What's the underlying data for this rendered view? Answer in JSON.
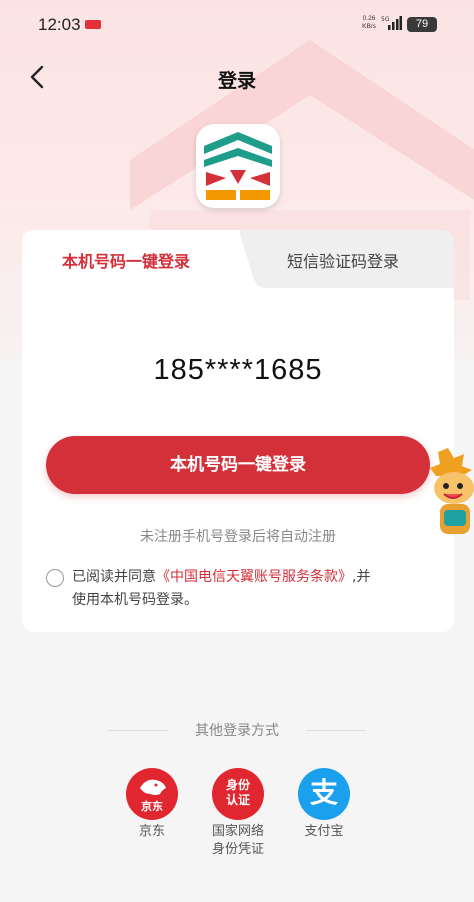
{
  "status_bar": {
    "time": "12:03",
    "net_speed": "0.26",
    "net_unit": "KB/s",
    "network_type": "5G",
    "battery": "79"
  },
  "nav": {
    "title": "登录"
  },
  "tabs": [
    {
      "label": "本机号码一键登录",
      "active": true
    },
    {
      "label": "短信验证码登录",
      "active": false
    }
  ],
  "phone_masked": "185****1685",
  "login_button": "本机号码一键登录",
  "auto_register_hint": "未注册手机号登录后将自动注册",
  "agreement": {
    "prefix": "已阅读并同意",
    "link": "《中国电信天翼账号服务条款》",
    "suffix": ",并",
    "line2": "使用本机号码登录。"
  },
  "other_login": {
    "title": "其他登录方式",
    "providers": [
      {
        "label": "京东",
        "icon": "jd-icon",
        "icon_text": "京东"
      },
      {
        "label": "国家网络\n身份凭证",
        "label_line1": "国家网络",
        "label_line2": "身份凭证",
        "icon": "national-id-icon",
        "icon_text_1": "身份",
        "icon_text_2": "认证"
      },
      {
        "label": "支付宝",
        "icon": "alipay-icon",
        "icon_text": "支"
      }
    ]
  },
  "colors": {
    "brand_red": "#d3303a",
    "alipay_blue": "#1ba0ee"
  }
}
